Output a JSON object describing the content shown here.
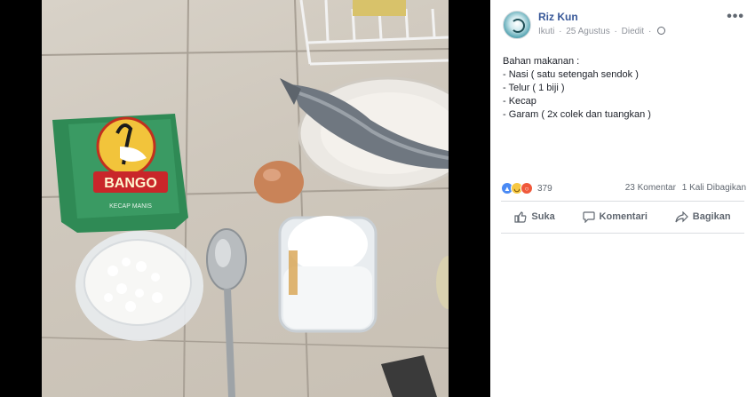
{
  "post": {
    "author": "Riz Kun",
    "follow_label": "Ikuti",
    "date": "25 Agustus",
    "edited": "Diedit",
    "separator": "·",
    "more": "•••",
    "caption_lines": [
      "Bahan makanan :",
      "- Nasi ( satu setengah sendok )",
      "- Telur ( 1 biji )",
      "- Kecap",
      "- Garam ( 2x colek dan tuangkan )"
    ],
    "reaction_count": "379",
    "comments": "23 Komentar",
    "shares": "1 Kali Dibagikan",
    "actions": {
      "like": "Suka",
      "comment": "Komentari",
      "share": "Bagikan"
    }
  },
  "photo": {
    "packet_brand": "BANGO",
    "packet_subtext": "KECAP MANIS"
  },
  "colors": {
    "link_blue": "#385898",
    "meta_gray": "#90949c",
    "packet_green": "#2f8a55"
  }
}
